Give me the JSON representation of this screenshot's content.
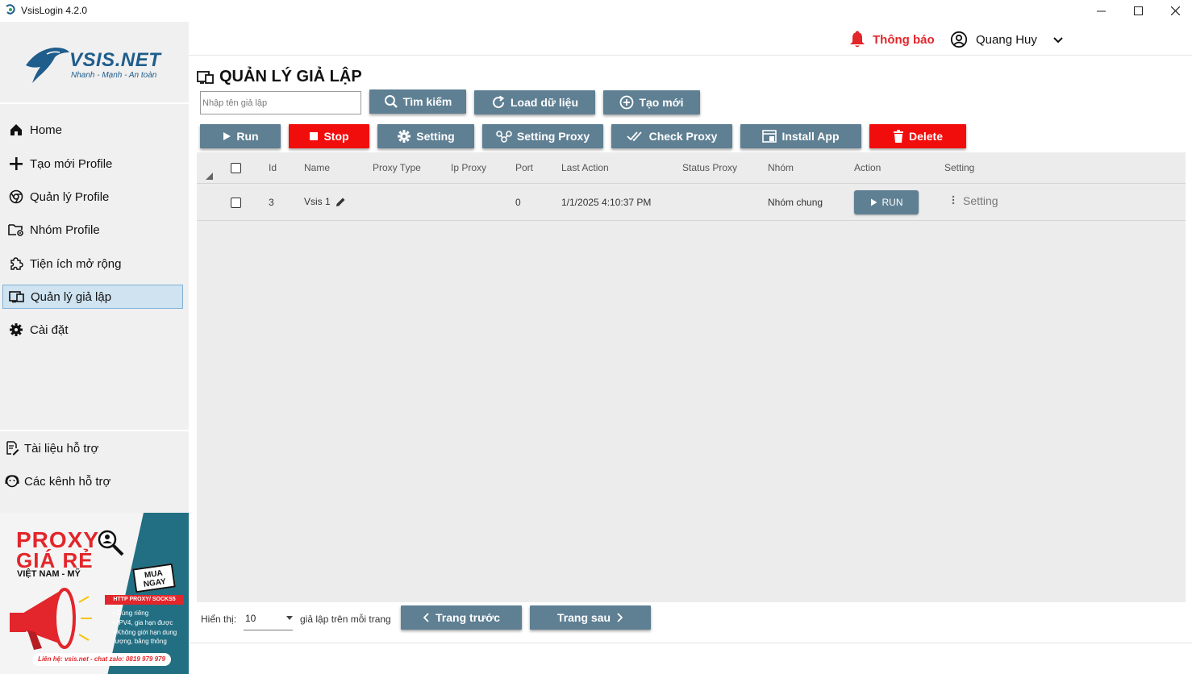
{
  "window": {
    "title": "VsisLogin 4.2.0",
    "minimize": "—",
    "maximize": "☐",
    "close": "✕"
  },
  "logo": {
    "brand": "VSIS.NET",
    "slogan": "Nhanh - Mạnh - An toàn"
  },
  "sidebar": {
    "items": [
      {
        "label": "Home",
        "icon": "home-icon"
      },
      {
        "label": "Tạo mới Profile",
        "icon": "plus-icon"
      },
      {
        "label": "Quản lý Profile",
        "icon": "chrome-icon"
      },
      {
        "label": "Nhóm Profile",
        "icon": "folder-gear-icon"
      },
      {
        "label": "Tiện ích mở rộng",
        "icon": "puzzle-icon"
      },
      {
        "label": "Quản lý giả lập",
        "icon": "devices-icon",
        "active": true
      },
      {
        "label": "Cài đặt",
        "icon": "gear-icon"
      }
    ],
    "support": [
      {
        "label": "Tài liệu hỗ trợ",
        "icon": "document-edit-icon"
      },
      {
        "label": "Các kênh hỗ trợ",
        "icon": "support-face-icon"
      }
    ]
  },
  "promo": {
    "line1": "PROXY",
    "line2": "GIÁ RẺ",
    "line3": "VIỆT NAM - MỸ",
    "buy_now": "MUA NGAY",
    "tag": "HTTP PROXY/ SOCKS5",
    "features": [
      "• Dùng riêng",
      "• IPV4, gia hạn được",
      "• Không giới hạn dung",
      "lượng, băng thông"
    ],
    "contact": "Liên hệ: vsis.net - chat zalo: 0819 979 979"
  },
  "header": {
    "notification_label": "Thông báo",
    "user_name": "Quang Huy"
  },
  "page": {
    "title": "QUẢN LÝ GIẢ LẬP",
    "search_placeholder": "Nhập tên giả lập"
  },
  "toolbar": {
    "search": "Tìm kiếm",
    "load": "Load dữ liệu",
    "create": "Tạo mới",
    "run": "Run",
    "stop": "Stop",
    "setting": "Setting",
    "setting_proxy": "Setting Proxy",
    "check_proxy": "Check Proxy",
    "install_app": "Install App",
    "delete": "Delete"
  },
  "table": {
    "columns": [
      "Id",
      "Name",
      "Proxy Type",
      "Ip Proxy",
      "Port",
      "Last Action",
      "Status Proxy",
      "Nhóm",
      "Action",
      "Setting"
    ],
    "rows": [
      {
        "id": "3",
        "name": "Vsis 1",
        "proxy_type": "",
        "ip_proxy": "",
        "port": "0",
        "last_action": "1/1/2025 4:10:37 PM",
        "status_proxy": "",
        "group": "Nhóm chung",
        "action_label": "RUN",
        "setting_label": "Setting"
      }
    ]
  },
  "pagination": {
    "show_label": "Hiển thị:",
    "per_page": "10",
    "per_page_suffix": "giả lập trên mỗi trang",
    "prev": "Trang trước",
    "next": "Trang sau"
  },
  "colors": {
    "primary_button": "#5f7f93",
    "danger_button": "#f20d0d",
    "active_nav": "#cfe3f1",
    "notification": "#e2262b",
    "promo_bg": "#226f83"
  }
}
